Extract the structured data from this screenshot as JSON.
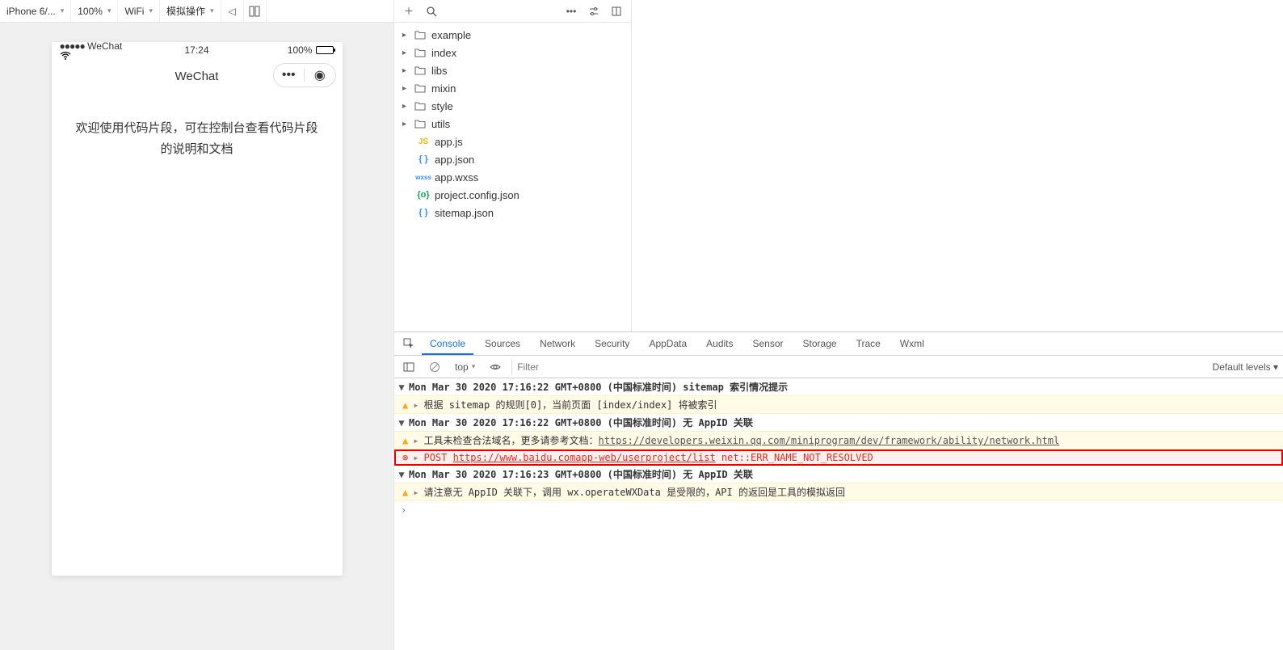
{
  "simToolbar": {
    "device": "iPhone 6/...",
    "zoom": "100%",
    "network": "WiFi",
    "action": "模拟操作"
  },
  "phone": {
    "carrier": "WeChat",
    "time": "17:24",
    "batteryPct": "100%",
    "signal": "●●●●●",
    "navTitle": "WeChat",
    "bodyText": "欢迎使用代码片段，可在控制台查看代码片段的说明和文档"
  },
  "fileTree": {
    "folders": [
      "example",
      "index",
      "libs",
      "mixin",
      "style",
      "utils"
    ],
    "files": [
      {
        "name": "app.js",
        "icon": "js",
        "label": "JS"
      },
      {
        "name": "app.json",
        "icon": "json",
        "label": "{ }"
      },
      {
        "name": "app.wxss",
        "icon": "wxss",
        "label": "wxss"
      },
      {
        "name": "project.config.json",
        "icon": "cfg",
        "label": "{o}"
      },
      {
        "name": "sitemap.json",
        "icon": "json",
        "label": "{ }"
      }
    ]
  },
  "devtools": {
    "tabs": [
      "Console",
      "Sources",
      "Network",
      "Security",
      "AppData",
      "Audits",
      "Sensor",
      "Storage",
      "Trace",
      "Wxml"
    ],
    "activeTab": "Console",
    "context": "top",
    "filterPlaceholder": "Filter",
    "levels": "Default levels ▾",
    "logs": [
      {
        "head": "Mon Mar 30 2020 17:16:22 GMT+0800 (中国标准时间) sitemap 索引情况提示",
        "level": "warn",
        "msg": "根据 sitemap 的规则[0]，当前页面 [index/index] 将被索引"
      },
      {
        "head": "Mon Mar 30 2020 17:16:22 GMT+0800 (中国标准时间) 无 AppID 关联",
        "level": "warn",
        "msg": "工具未检查合法域名，更多请参考文档：",
        "link": "https://developers.weixin.qq.com/miniprogram/dev/framework/ability/network.html"
      },
      {
        "level": "error",
        "method": "POST",
        "url": "https://www.baidu.comapp-web/userproject/list",
        "tail": "net::ERR_NAME_NOT_RESOLVED"
      },
      {
        "head": "Mon Mar 30 2020 17:16:23 GMT+0800 (中国标准时间) 无 AppID 关联",
        "level": "warn",
        "msg": "请注意无 AppID 关联下，调用 wx.operateWXData 是受限的，API 的返回是工具的模拟返回"
      }
    ]
  }
}
